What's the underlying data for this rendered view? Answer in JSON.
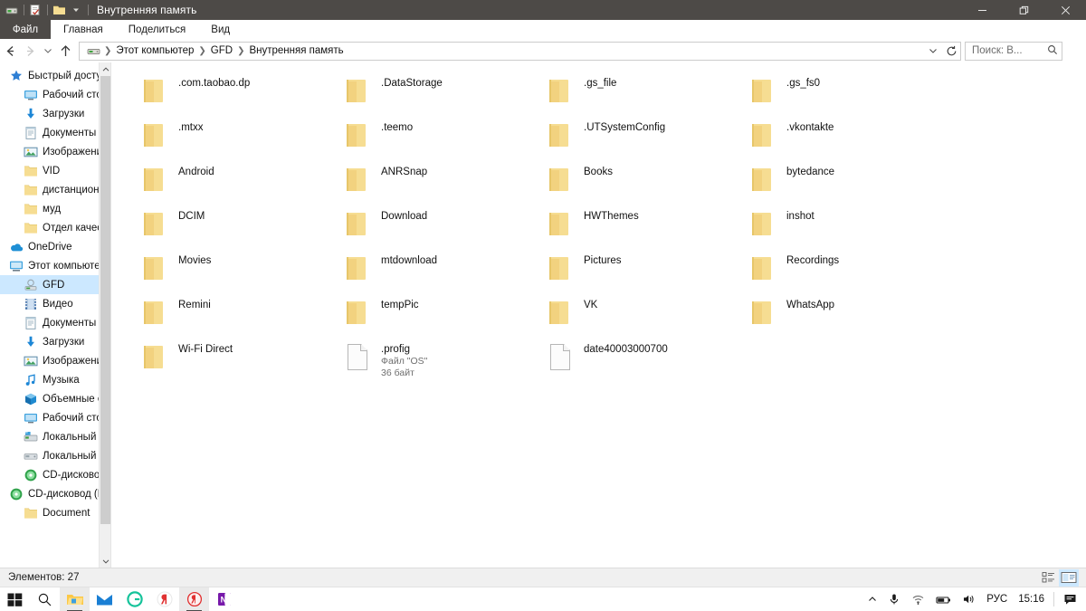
{
  "window": {
    "title": "Внутренняя память",
    "quick_access": [
      {
        "icon": "drive-icon",
        "name": "qat-drive"
      },
      {
        "icon": "properties-icon",
        "name": "qat-properties"
      },
      {
        "icon": "new-folder-icon",
        "name": "qat-new-folder"
      },
      {
        "icon": "chevron-down-icon",
        "name": "qat-customize"
      }
    ],
    "controls": {
      "minimize": "─",
      "restore": "❐",
      "close": "✕"
    }
  },
  "ribbon": {
    "file_tab": "Файл",
    "tabs": [
      "Главная",
      "Поделиться",
      "Вид"
    ]
  },
  "nav": {
    "back": "←",
    "forward": "→",
    "recent": "⌄",
    "up": "↑",
    "breadcrumb": [
      "Этот компьютер",
      "GFD",
      "Внутренняя память"
    ],
    "dropdown": "⌄",
    "refresh": "↻"
  },
  "search": {
    "placeholder": "Поиск: В...",
    "icon": "search-icon"
  },
  "sidebar": {
    "items": [
      {
        "label": "Быстрый доступ",
        "icon": "star-icon",
        "level": 0,
        "selected": false,
        "pinned": false
      },
      {
        "label": "Рабочий сто",
        "icon": "desktop-icon",
        "level": 1,
        "selected": false,
        "pinned": true
      },
      {
        "label": "Загрузки",
        "icon": "download-icon",
        "level": 1,
        "selected": false,
        "pinned": true
      },
      {
        "label": "Документы",
        "icon": "documents-icon",
        "level": 1,
        "selected": false,
        "pinned": true
      },
      {
        "label": "Изображени",
        "icon": "pictures-icon",
        "level": 1,
        "selected": false,
        "pinned": true
      },
      {
        "label": "VID",
        "icon": "folder-icon",
        "level": 1,
        "selected": false,
        "pinned": false
      },
      {
        "label": "дистанционка",
        "icon": "folder-icon",
        "level": 1,
        "selected": false,
        "pinned": false
      },
      {
        "label": "муд",
        "icon": "folder-icon",
        "level": 1,
        "selected": false,
        "pinned": false
      },
      {
        "label": "Отдел качества",
        "icon": "folder-icon",
        "level": 1,
        "selected": false,
        "pinned": false
      },
      {
        "label": "OneDrive",
        "icon": "onedrive-icon",
        "level": 0,
        "selected": false,
        "pinned": false
      },
      {
        "label": "Этот компьютер",
        "icon": "thispc-icon",
        "level": 0,
        "selected": false,
        "pinned": false
      },
      {
        "label": "GFD",
        "icon": "phone-icon",
        "level": 1,
        "selected": true,
        "pinned": false
      },
      {
        "label": "Видео",
        "icon": "video-icon",
        "level": 1,
        "selected": false,
        "pinned": false
      },
      {
        "label": "Документы",
        "icon": "documents-icon",
        "level": 1,
        "selected": false,
        "pinned": false
      },
      {
        "label": "Загрузки",
        "icon": "download-icon",
        "level": 1,
        "selected": false,
        "pinned": false
      },
      {
        "label": "Изображения",
        "icon": "pictures-icon",
        "level": 1,
        "selected": false,
        "pinned": false
      },
      {
        "label": "Музыка",
        "icon": "music-icon",
        "level": 1,
        "selected": false,
        "pinned": false
      },
      {
        "label": "Объемные объ",
        "icon": "3dobjects-icon",
        "level": 1,
        "selected": false,
        "pinned": false
      },
      {
        "label": "Рабочий стол",
        "icon": "desktop-icon",
        "level": 1,
        "selected": false,
        "pinned": false
      },
      {
        "label": "Локальный дис",
        "icon": "systemdisk-icon",
        "level": 1,
        "selected": false,
        "pinned": false
      },
      {
        "label": "Локальный дис",
        "icon": "harddisk-icon",
        "level": 1,
        "selected": false,
        "pinned": false
      },
      {
        "label": "CD-дисковод (F",
        "icon": "cddrive-icon",
        "level": 1,
        "selected": false,
        "pinned": false
      },
      {
        "label": "CD-дисковод (F:)",
        "icon": "cddrive-icon",
        "level": 0,
        "selected": false,
        "pinned": false
      },
      {
        "label": "Document",
        "icon": "folder-icon",
        "level": 1,
        "selected": false,
        "pinned": false
      }
    ],
    "scroll_up": "⌃",
    "scroll_down": "⌄"
  },
  "files": [
    {
      "name": ".com.taobao.dp",
      "type": "folder",
      "sub1": "",
      "sub2": ""
    },
    {
      "name": ".DataStorage",
      "type": "folder",
      "sub1": "",
      "sub2": ""
    },
    {
      "name": ".gs_file",
      "type": "folder",
      "sub1": "",
      "sub2": ""
    },
    {
      "name": ".gs_fs0",
      "type": "folder",
      "sub1": "",
      "sub2": ""
    },
    {
      "name": ".mtxx",
      "type": "folder",
      "sub1": "",
      "sub2": ""
    },
    {
      "name": ".teemo",
      "type": "folder",
      "sub1": "",
      "sub2": ""
    },
    {
      "name": ".UTSystemConfig",
      "type": "folder",
      "sub1": "",
      "sub2": ""
    },
    {
      "name": ".vkontakte",
      "type": "folder",
      "sub1": "",
      "sub2": ""
    },
    {
      "name": "Android",
      "type": "folder",
      "sub1": "",
      "sub2": ""
    },
    {
      "name": "ANRSnap",
      "type": "folder",
      "sub1": "",
      "sub2": ""
    },
    {
      "name": "Books",
      "type": "folder",
      "sub1": "",
      "sub2": ""
    },
    {
      "name": "bytedance",
      "type": "folder",
      "sub1": "",
      "sub2": ""
    },
    {
      "name": "DCIM",
      "type": "folder",
      "sub1": "",
      "sub2": ""
    },
    {
      "name": "Download",
      "type": "folder",
      "sub1": "",
      "sub2": ""
    },
    {
      "name": "HWThemes",
      "type": "folder",
      "sub1": "",
      "sub2": ""
    },
    {
      "name": "inshot",
      "type": "folder",
      "sub1": "",
      "sub2": ""
    },
    {
      "name": "Movies",
      "type": "folder",
      "sub1": "",
      "sub2": ""
    },
    {
      "name": "mtdownload",
      "type": "folder",
      "sub1": "",
      "sub2": ""
    },
    {
      "name": "Pictures",
      "type": "folder",
      "sub1": "",
      "sub2": ""
    },
    {
      "name": "Recordings",
      "type": "folder",
      "sub1": "",
      "sub2": ""
    },
    {
      "name": "Remini",
      "type": "folder",
      "sub1": "",
      "sub2": ""
    },
    {
      "name": "tempPic",
      "type": "folder",
      "sub1": "",
      "sub2": ""
    },
    {
      "name": "VK",
      "type": "folder",
      "sub1": "",
      "sub2": ""
    },
    {
      "name": "WhatsApp",
      "type": "folder",
      "sub1": "",
      "sub2": ""
    },
    {
      "name": "Wi-Fi Direct",
      "type": "folder",
      "sub1": "",
      "sub2": ""
    },
    {
      "name": ".profig",
      "type": "file",
      "sub1": "Файл \"OS\"",
      "sub2": "36 байт"
    },
    {
      "name": "date40003000700",
      "type": "file",
      "sub1": "",
      "sub2": ""
    }
  ],
  "statusbar": {
    "count_text": "Элементов: 27",
    "views": [
      {
        "name": "details-view-button",
        "icon": "details-icon",
        "selected": false
      },
      {
        "name": "large-icons-view-button",
        "icon": "large-icons-icon",
        "selected": true
      }
    ]
  },
  "taskbar": {
    "items": [
      {
        "name": "start-button",
        "icon": "windows-logo-icon",
        "active": false
      },
      {
        "name": "search-taskbar-button",
        "icon": "search-icon",
        "active": false
      },
      {
        "name": "file-explorer-taskbar-button",
        "icon": "folder-icon",
        "active": true
      },
      {
        "name": "mail-taskbar-button",
        "icon": "mail-icon",
        "active": false
      },
      {
        "name": "grammarly-taskbar-button",
        "icon": "grammarly-icon",
        "active": false
      },
      {
        "name": "yandex-taskbar-button",
        "icon": "yandex-icon",
        "active": false
      },
      {
        "name": "yandex-browser-taskbar-button",
        "icon": "yandex-browser-icon",
        "active": true
      },
      {
        "name": "onenote-taskbar-button",
        "icon": "onenote-icon",
        "active": false
      }
    ],
    "tray": {
      "expand": "⌃",
      "language": "РУС",
      "time": "15:16"
    }
  },
  "colors": {
    "titlebar": "#4d4a47",
    "folder": "#f6dd92",
    "selection": "#cce8ff",
    "accent": "#0078d7"
  }
}
